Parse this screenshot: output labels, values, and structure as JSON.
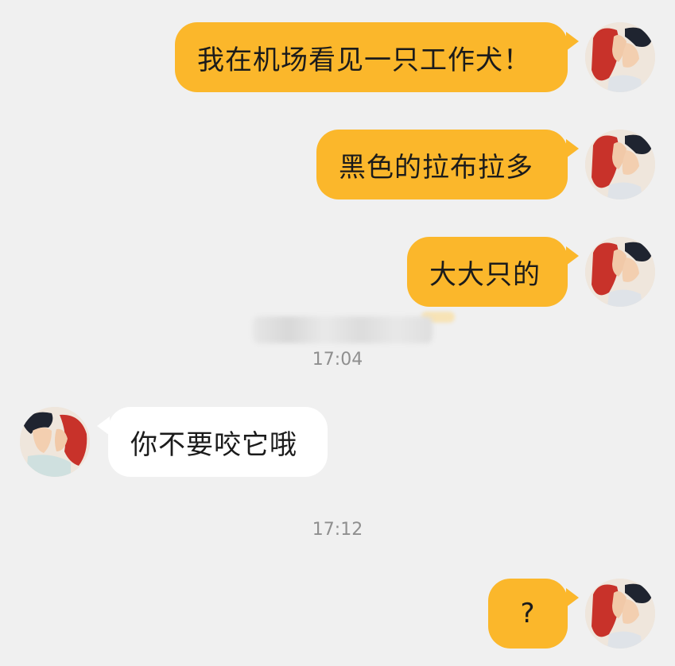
{
  "messages": [
    {
      "direction": "outgoing",
      "text": "我在机场看见一只工作犬！"
    },
    {
      "direction": "outgoing",
      "text": "黑色的拉布拉多"
    },
    {
      "direction": "outgoing",
      "text": "大大只的"
    },
    {
      "direction": "incoming",
      "text": "你不要咬它哦"
    },
    {
      "direction": "outgoing",
      "text": "?"
    }
  ],
  "timestamps": [
    "17:04",
    "17:12"
  ],
  "colors": {
    "background": "#f0f0f0",
    "outgoing_bubble": "#fbb72b",
    "incoming_bubble": "#ffffff",
    "timestamp_text": "#8f8f8f"
  },
  "icons": {
    "self_avatar": "avatar-icon",
    "other_avatar": "avatar-icon"
  }
}
